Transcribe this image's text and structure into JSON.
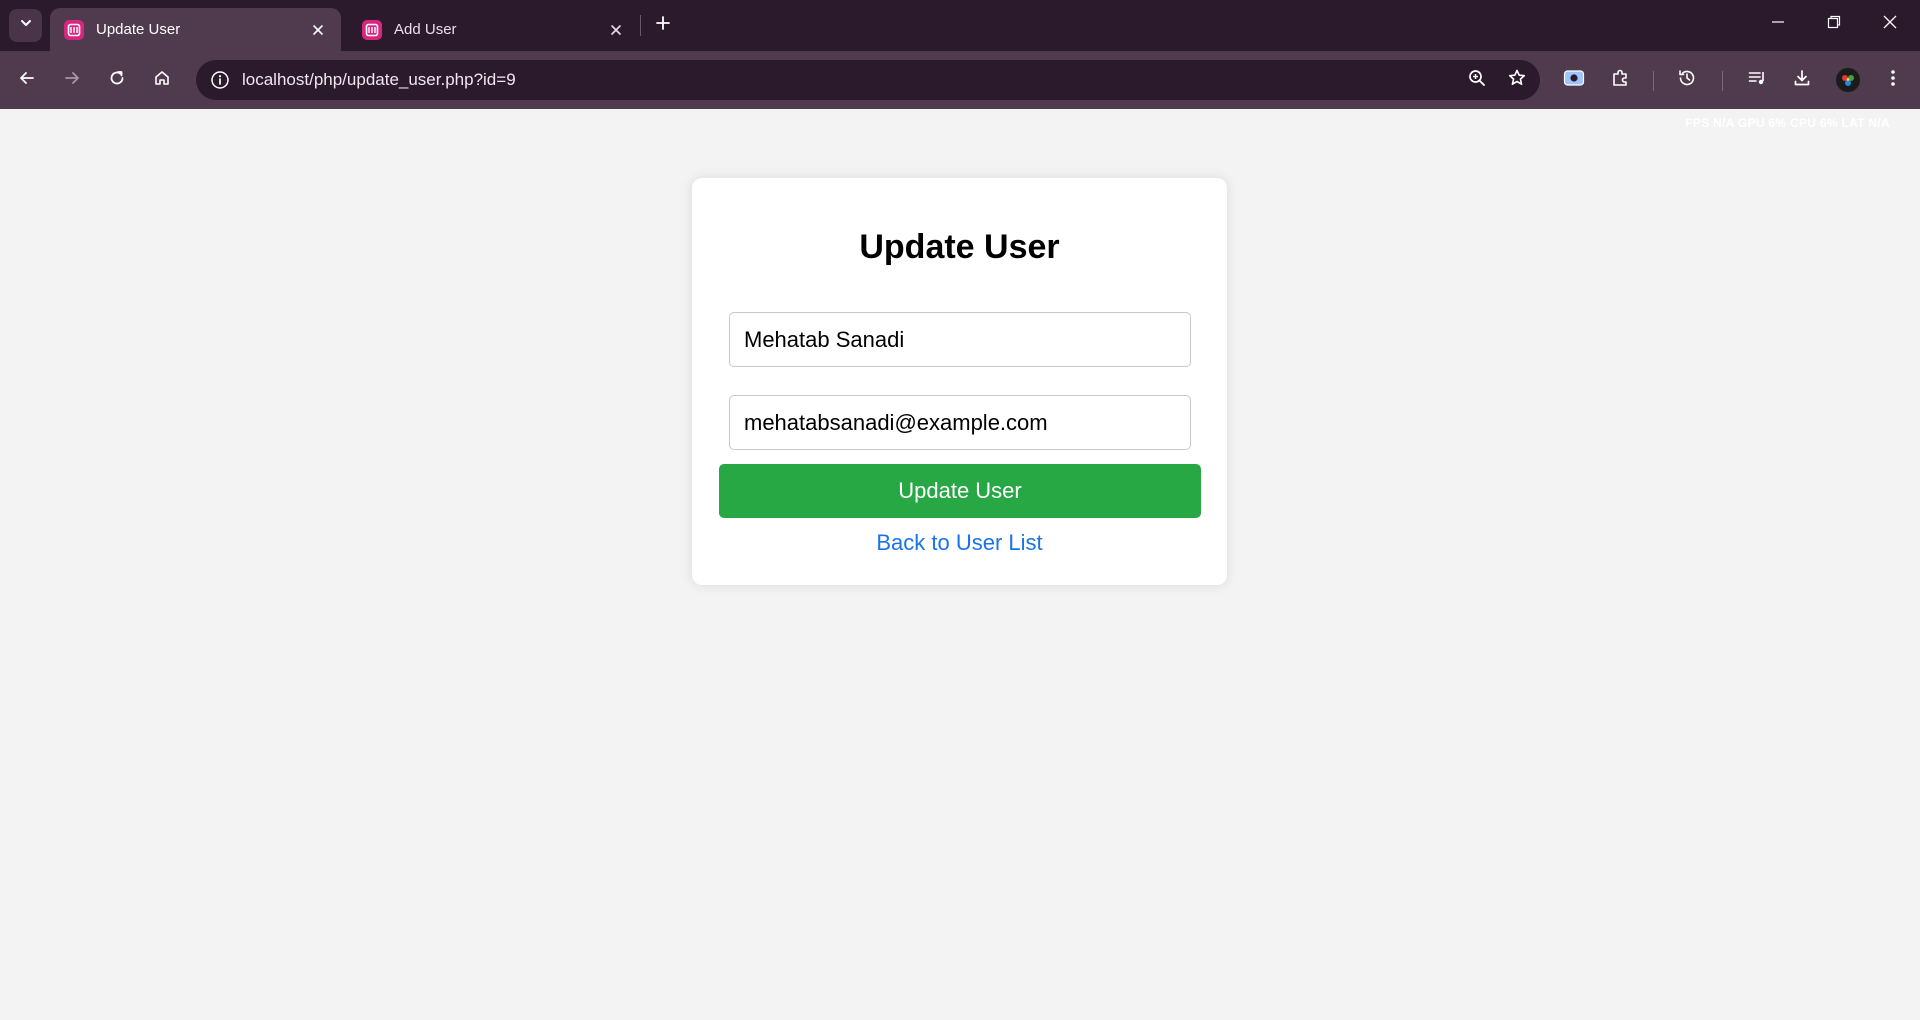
{
  "browser": {
    "tabs": [
      {
        "title": "Update User",
        "active": true
      },
      {
        "title": "Add User",
        "active": false
      }
    ],
    "address_bar": {
      "url": "localhost/php/update_user.php?id=9"
    },
    "perf_overlay": "FPS N/A GPU 6% CPU 6% LAT N/A"
  },
  "icons": {
    "tab_search": "chevron-down-icon",
    "favicon": "app-favicon-icon",
    "close": "close-icon",
    "new_tab": "plus-icon",
    "back": "arrow-left-icon",
    "forward": "arrow-right-icon",
    "reload": "reload-icon",
    "home": "home-icon",
    "site_info": "info-icon",
    "zoom": "zoom-icon",
    "bookmark": "star-icon",
    "screenshot": "screenshot-icon",
    "extensions": "puzzle-icon",
    "history": "history-icon",
    "media": "media-queue-icon",
    "download": "download-icon",
    "profile": "profile-avatar-icon",
    "menu": "kebab-menu-icon"
  },
  "colors": {
    "tabstrip_bg": "#2b1a2b",
    "toolbar_bg": "#4f3a4e",
    "page_bg": "#f3f3f3",
    "submit_green": "#28a745",
    "link_blue": "#1a73e8",
    "favicon_pink": "#d7267f"
  },
  "form": {
    "title": "Update User",
    "name_value": "Mehatab Sanadi",
    "email_value": "mehatabsanadi@example.com",
    "submit_label": "Update User",
    "back_link": "Back to User List"
  }
}
